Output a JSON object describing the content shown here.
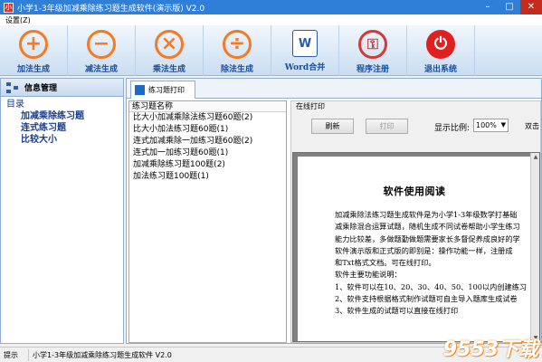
{
  "window": {
    "title": "小学1-3年级加减乘除练习题生成软件(演示版) V2.0",
    "controls": [
      "–",
      "□",
      "✕"
    ]
  },
  "menu": {
    "settings": "设置(Z)"
  },
  "toolbar": {
    "buttons": [
      {
        "label": "加法生成",
        "icon": "plus-icon",
        "glyph": "+"
      },
      {
        "label": "减法生成",
        "icon": "minus-icon",
        "glyph": "−"
      },
      {
        "label": "乘法生成",
        "icon": "multiply-icon",
        "glyph": "×"
      },
      {
        "label": "除法生成",
        "icon": "divide-icon",
        "glyph": "÷"
      },
      {
        "label": "Word合并",
        "icon": "word-doc-icon",
        "glyph": "W"
      },
      {
        "label": "程序注册",
        "icon": "key-icon",
        "glyph": "⚿"
      },
      {
        "label": "退出系统",
        "icon": "power-icon",
        "glyph": "⏻"
      }
    ],
    "accent": "#f57a25"
  },
  "sidebar": {
    "header": "信息管理",
    "root": "目录",
    "items": [
      "加减乘除练习题",
      "连式练习题",
      "比较大小"
    ]
  },
  "tab": {
    "label": "练习题打印"
  },
  "list": {
    "header": "练习题名称",
    "items": [
      "比大小加减乘除法练习题60题(2)",
      "比大小加法练习题60题(1)",
      "连式加减乘除一加练习题60题(2)",
      "连式加一加练习题60题(1)",
      "加减乘除练习题100题(2)",
      "加法练习题100题(1)"
    ]
  },
  "print": {
    "group_label": "在线打印",
    "refresh": "刷新",
    "print": "打印",
    "zoom_label": "显示比例:",
    "zoom_value": "100%",
    "extra": "双击"
  },
  "document": {
    "title": "软件使用阅读",
    "lines": [
      "加减乘除法练习题生成软件是为小学1-3年级数学打基础",
      "减乘除混合运算试题，随机生成不同试卷帮助小学生练习",
      "能力比较差，多做题勤做题需要家长多督促养成良好的学",
      "软件演示版和正式版的即别是：操作功能一样，注册成",
      "和Txt格式文档。可在线打印。",
      "软件主要功能说明：",
      "1、软件可以在10、20、30、40、50、100以内创建练习",
      "2、软件支持根据格式制作试题可自主导入题库生成试卷",
      "3、软件生成的试题可以直接在线打印"
    ]
  },
  "status": {
    "label": "提示",
    "text": "小学1-3年级加减乘除练习题生成软件 V2.0"
  },
  "watermark": "9553下载"
}
